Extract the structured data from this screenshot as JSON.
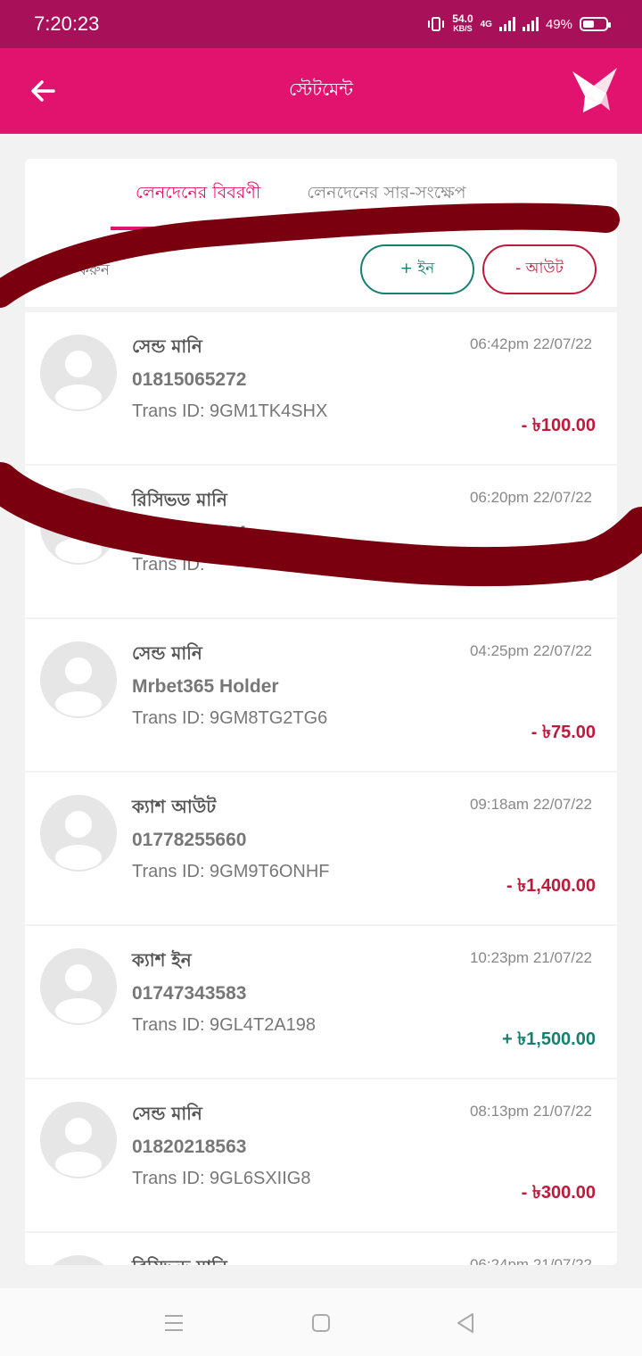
{
  "status_bar": {
    "time": "7:20:23",
    "net_speed_value": "54.0",
    "net_speed_unit": "KB/S",
    "network_type": "4G",
    "battery": "49%"
  },
  "app_bar": {
    "title": "স্টেটমেন্ট"
  },
  "tabs": [
    {
      "label": "লেনদেনের বিবরণী",
      "active": true
    },
    {
      "label": "লেনদেনের সার-সংক্ষেপ",
      "active": false
    }
  ],
  "filter": {
    "search_label": "করুন",
    "in_label": "+ ইন",
    "out_label": "- আউট"
  },
  "transactions": [
    {
      "type": "সেন্ড মানি",
      "party": "01815065272",
      "trans_id": "Trans ID: 9GM1TK4SHX",
      "time": "06:42pm 22/07/22",
      "amount": "- ৳100.00",
      "direction": "out"
    },
    {
      "type": "রিসিভড মানি",
      "party": "01877176724",
      "trans_id": "Trans ID:",
      "time": "06:20pm 22/07/22",
      "amount": ".00",
      "direction": "in"
    },
    {
      "type": "সেন্ড মানি",
      "party": "Mrbet365 Holder",
      "trans_id": "Trans ID: 9GM8TG2TG6",
      "time": "04:25pm 22/07/22",
      "amount": "- ৳75.00",
      "direction": "out"
    },
    {
      "type": "ক্যাশ আউট",
      "party": "01778255660",
      "trans_id": "Trans ID: 9GM9T6ONHF",
      "time": "09:18am 22/07/22",
      "amount": "- ৳1,400.00",
      "direction": "out"
    },
    {
      "type": "ক্যাশ ইন",
      "party": "01747343583",
      "trans_id": "Trans ID: 9GL4T2A198",
      "time": "10:23pm 21/07/22",
      "amount": "+ ৳1,500.00",
      "direction": "in"
    },
    {
      "type": "সেন্ড মানি",
      "party": "01820218563",
      "trans_id": "Trans ID: 9GL6SXIIG8",
      "time": "08:13pm 21/07/22",
      "amount": "- ৳300.00",
      "direction": "out"
    },
    {
      "type": "রিসিভড মানি",
      "party": "",
      "trans_id": "",
      "time": "06:24pm 21/07/22",
      "amount": "",
      "direction": "in"
    }
  ],
  "colors": {
    "brand": "#e2136e",
    "status_bar": "#a8105a",
    "amount_out": "#c0193c",
    "amount_in": "#16806f",
    "scribble": "#7a0010"
  },
  "icons": {
    "back": "arrow-left-icon",
    "logo": "bkash-bird-logo",
    "avatar": "user-placeholder-icon",
    "nav_menu": "menu-lines-icon",
    "nav_home": "square-home-icon",
    "nav_back": "triangle-back-icon"
  }
}
